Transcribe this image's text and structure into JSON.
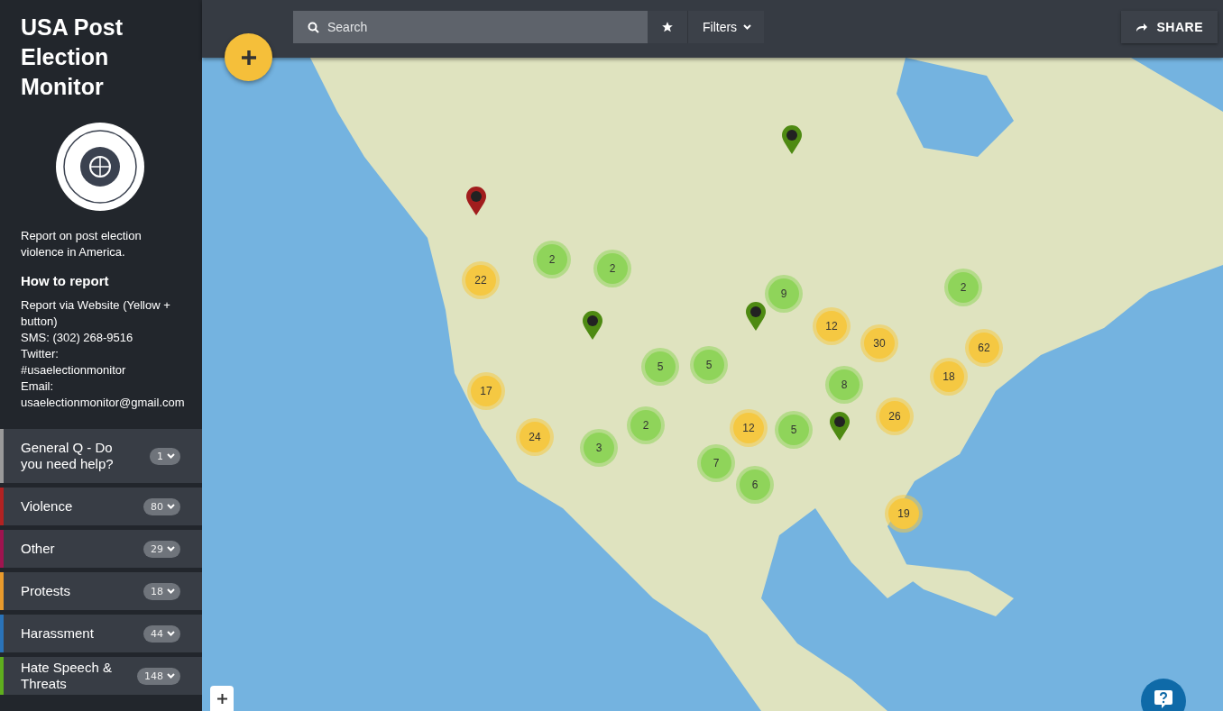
{
  "sidebar": {
    "title": "USA Post Election Monitor",
    "description": "Report on post election violence in America.",
    "how_to_heading": "How to report",
    "how_to_lines": [
      "Report via Website (Yellow + button)",
      "SMS: (302) 268-9516",
      "Twitter:",
      "#usaelectionmonitor",
      "Email:",
      "usaelectionmonitor@gmail.com"
    ],
    "categories": [
      {
        "label": "General Q - Do you need help?",
        "count": "1",
        "color": "#9a9a9a"
      },
      {
        "label": "Violence",
        "count": "80",
        "color": "#b22222"
      },
      {
        "label": "Other",
        "count": "29",
        "color": "#a0144f"
      },
      {
        "label": "Protests",
        "count": "18",
        "color": "#e89a2c"
      },
      {
        "label": "Harassment",
        "count": "44",
        "color": "#2a73b8"
      },
      {
        "label": "Hate Speech & Threats",
        "count": "148",
        "color": "#5fae1e"
      }
    ]
  },
  "toolbar": {
    "search": {
      "placeholder": "Search"
    },
    "filters": "Filters",
    "share": "SHARE"
  },
  "map": {
    "clusters": [
      {
        "count": "22",
        "color": "#f5c842"
      },
      {
        "count": "2",
        "color": "#8fd45a"
      },
      {
        "count": "2",
        "color": "#8fd45a"
      },
      {
        "count": "9",
        "color": "#8fd45a"
      },
      {
        "count": "12",
        "color": "#f5c842"
      },
      {
        "count": "30",
        "color": "#f5c842"
      },
      {
        "count": "2",
        "color": "#8fd45a"
      },
      {
        "count": "62",
        "color": "#f5c842"
      },
      {
        "count": "18",
        "color": "#f5c842"
      },
      {
        "count": "8",
        "color": "#8fd45a"
      },
      {
        "count": "5",
        "color": "#8fd45a"
      },
      {
        "count": "5",
        "color": "#8fd45a"
      },
      {
        "count": "17",
        "color": "#f5c842"
      },
      {
        "count": "26",
        "color": "#f5c842"
      },
      {
        "count": "2",
        "color": "#8fd45a"
      },
      {
        "count": "12",
        "color": "#f5c842"
      },
      {
        "count": "5",
        "color": "#8fd45a"
      },
      {
        "count": "24",
        "color": "#f5c842"
      },
      {
        "count": "3",
        "color": "#8fd45a"
      },
      {
        "count": "7",
        "color": "#8fd45a"
      },
      {
        "count": "6",
        "color": "#8fd45a"
      },
      {
        "count": "19",
        "color": "#f5c842"
      }
    ],
    "pins": [
      {
        "color": "#a11d1d"
      },
      {
        "color": "#4e8a12"
      },
      {
        "color": "#4e8a12"
      },
      {
        "color": "#4e8a12"
      },
      {
        "color": "#4e8a12"
      }
    ]
  }
}
